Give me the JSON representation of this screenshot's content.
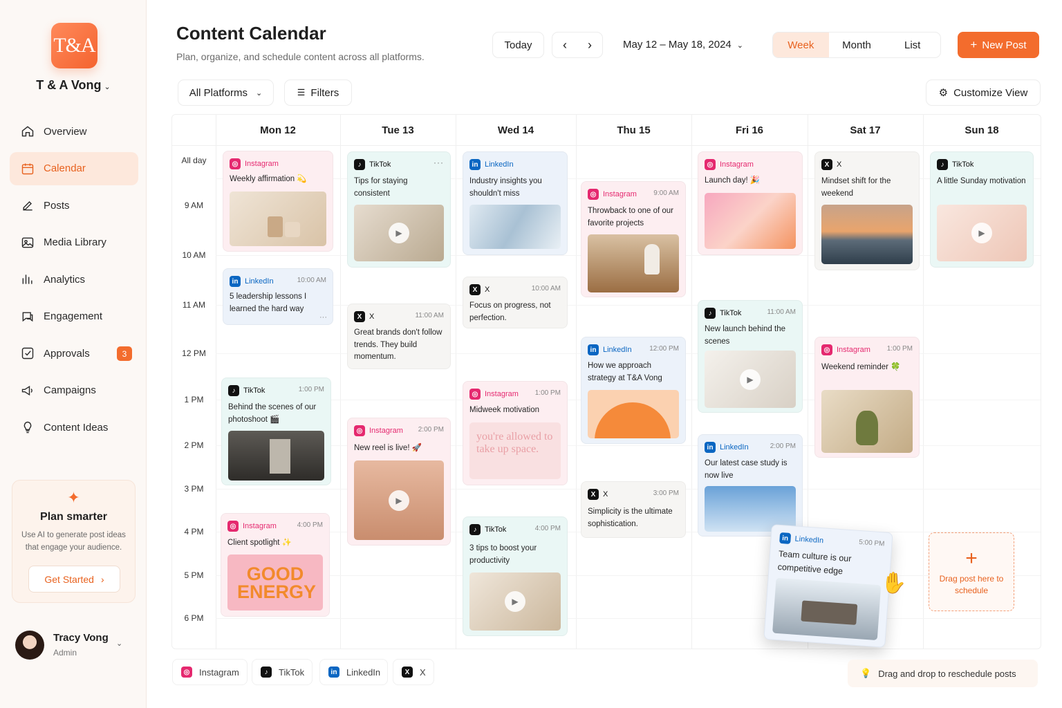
{
  "brand": {
    "logo": "T&A",
    "name": "T & A Vong"
  },
  "nav": [
    {
      "label": "Overview",
      "icon": "home-icon"
    },
    {
      "label": "Calendar",
      "icon": "calendar-icon",
      "active": true
    },
    {
      "label": "Posts",
      "icon": "edit-icon"
    },
    {
      "label": "Media Library",
      "icon": "image-icon"
    },
    {
      "label": "Analytics",
      "icon": "bar-chart-icon"
    },
    {
      "label": "Engagement",
      "icon": "chat-icon"
    },
    {
      "label": "Approvals",
      "icon": "check-square-icon",
      "badge": "3"
    },
    {
      "label": "Campaigns",
      "icon": "megaphone-icon"
    },
    {
      "label": "Content Ideas",
      "icon": "lightbulb-icon"
    }
  ],
  "promo": {
    "title": "Plan smarter",
    "text": "Use AI to generate post ideas that engage your audience.",
    "button": "Get Started"
  },
  "user": {
    "name": "Tracy Vong",
    "role": "Admin"
  },
  "header": {
    "title": "Content Calendar",
    "subtitle": "Plan, organize, and schedule content across all platforms.",
    "today": "Today",
    "range": "May 12 – May 18, 2024",
    "views": [
      "Week",
      "Month",
      "List"
    ],
    "active_view": "Week",
    "new_post": "New Post"
  },
  "toolbar": {
    "platforms": "All Platforms",
    "filters": "Filters",
    "customize": "Customize View"
  },
  "calendar": {
    "days": [
      "Mon 12",
      "Tue 13",
      "Wed 14",
      "Thu 15",
      "Fri 16",
      "Sat 17",
      "Sun 18"
    ],
    "times": [
      "All day",
      "9 AM",
      "10 AM",
      "11 AM",
      "12 PM",
      "1 PM",
      "2 PM",
      "3 PM",
      "4 PM",
      "5 PM",
      "6 PM"
    ],
    "posts": [
      {
        "platform": "Instagram",
        "time": "",
        "text": "Weekly affirmation 💫",
        "image": "ceramics"
      },
      {
        "platform": "LinkedIn",
        "time": "10:00 AM",
        "text": "5 leadership lessons I learned the hard way",
        "image": ""
      },
      {
        "platform": "TikTok",
        "time": "1:00 PM",
        "text": "Behind the scenes of our photoshoot 🎬",
        "image": "studio"
      },
      {
        "platform": "Instagram",
        "time": "4:00 PM",
        "text": "Client spotlight ✨",
        "image": "good-energy",
        "image_text": "GOOD ENERGY"
      },
      {
        "platform": "TikTok",
        "time": "",
        "text": "Tips for staying consistent",
        "image": "leaves-video"
      },
      {
        "platform": "X",
        "time": "11:00 AM",
        "text": "Great brands don't follow trends. They build momentum.",
        "image": ""
      },
      {
        "platform": "Instagram",
        "time": "2:00 PM",
        "text": "New reel is live! 🚀",
        "image": "woman-video"
      },
      {
        "platform": "LinkedIn",
        "time": "",
        "text": "Industry insights you shouldn't miss",
        "image": "abstract-blue"
      },
      {
        "platform": "X",
        "time": "10:00 AM",
        "text": "Focus on progress, not perfection.",
        "image": ""
      },
      {
        "platform": "Instagram",
        "time": "1:00 PM",
        "text": "Midweek motivation",
        "image": "quote",
        "image_text": "you're allowed to take up space."
      },
      {
        "platform": "TikTok",
        "time": "4:00 PM",
        "text": "3 tips to boost your productivity",
        "image": "notebook-video"
      },
      {
        "platform": "Instagram",
        "time": "9:00 AM",
        "text": "Throwback to one of our favorite projects",
        "image": "vase"
      },
      {
        "platform": "LinkedIn",
        "time": "12:00 PM",
        "text": "How we approach strategy at T&A Vong",
        "image": "orange-arc"
      },
      {
        "platform": "X",
        "time": "3:00 PM",
        "text": "Simplicity is the ultimate sophistication.",
        "image": ""
      },
      {
        "platform": "Instagram",
        "time": "",
        "text": "Launch day! 🎉",
        "image": "pink-gradient"
      },
      {
        "platform": "TikTok",
        "time": "11:00 AM",
        "text": "New launch behind the scenes",
        "image": "desk-video"
      },
      {
        "platform": "LinkedIn",
        "time": "2:00 PM",
        "text": "Our latest case study is now live",
        "image": "building"
      },
      {
        "platform": "X",
        "time": "",
        "text": "Mindset shift for the weekend",
        "image": "sunset"
      },
      {
        "platform": "Instagram",
        "time": "1:00 PM",
        "text": "Weekend reminder 🍀",
        "image": "plant"
      },
      {
        "platform": "TikTok",
        "time": "",
        "text": "A little Sunday motivation",
        "image": "bed-video"
      }
    ],
    "dragging": {
      "platform": "LinkedIn",
      "time": "5:00 PM",
      "text": "Team culture is our competitive edge",
      "image": "office"
    },
    "dropzone": "Drag post here to schedule"
  },
  "legend": [
    "Instagram",
    "TikTok",
    "LinkedIn",
    "X"
  ],
  "hint": "Drag and drop to reschedule posts",
  "colors": {
    "accent": "#f36c2d",
    "instagram": "#e5296f",
    "linkedin": "#0a66c2",
    "tiktok": "#111111"
  }
}
